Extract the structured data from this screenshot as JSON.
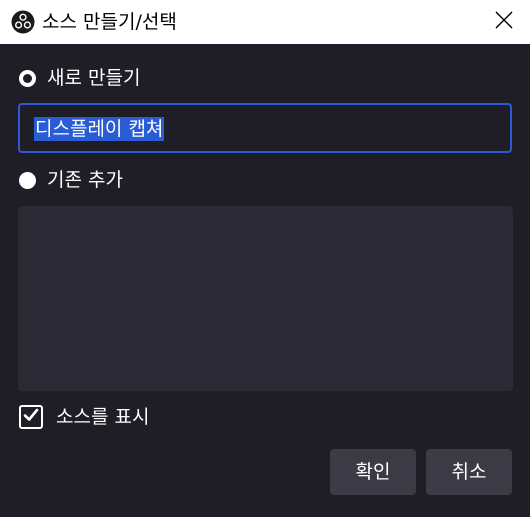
{
  "window": {
    "title": "소스 만들기/선택"
  },
  "icons": {
    "app": "obs-logo-icon",
    "close": "close-icon",
    "check": "checkmark-icon"
  },
  "options": {
    "create_new_label": "새로 만들기",
    "create_new_selected": true,
    "source_name_value": "디스플레이 캡쳐",
    "add_existing_label": "기존 추가",
    "add_existing_selected": false
  },
  "visibility": {
    "label": "소스를 표시",
    "checked": true
  },
  "buttons": {
    "ok_label": "확인",
    "cancel_label": "취소"
  },
  "colors": {
    "background": "#1f1e26",
    "accent": "#2f59d6",
    "selection": "#2a5cd6",
    "button": "#3b3a45",
    "list_bg": "#2b2a34"
  }
}
